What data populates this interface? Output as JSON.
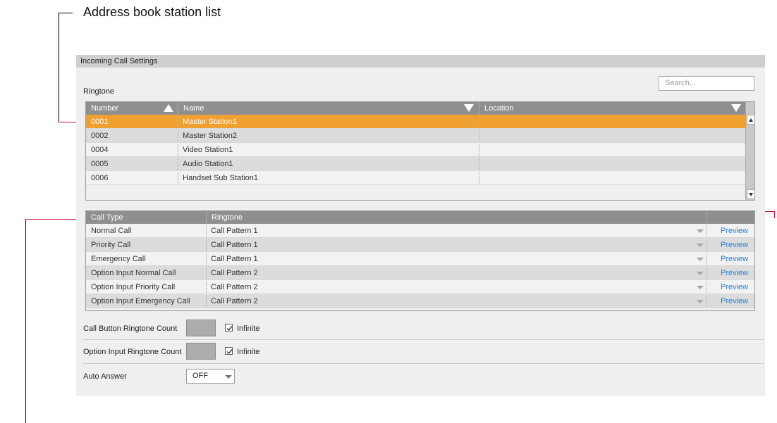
{
  "callout": {
    "title": "Address book station list"
  },
  "panel": {
    "header": "Incoming Call Settings",
    "search_placeholder": "Search...",
    "ringtone_label": "Ringtone"
  },
  "station_table": {
    "headers": {
      "number": "Number",
      "name": "Name",
      "location": "Location"
    },
    "rows": [
      {
        "number": "0001",
        "name": "Master Station1",
        "location": "",
        "selected": true
      },
      {
        "number": "0002",
        "name": "Master Station2",
        "location": ""
      },
      {
        "number": "0004",
        "name": "Video Station1",
        "location": ""
      },
      {
        "number": "0005",
        "name": "Audio Station1",
        "location": ""
      },
      {
        "number": "0006",
        "name": "Handset Sub Station1",
        "location": ""
      }
    ]
  },
  "ringtone_table": {
    "headers": {
      "call_type": "Call Type",
      "ringtone": "Ringtone"
    },
    "preview_label": "Preview",
    "rows": [
      {
        "call_type": "Normal Call",
        "ringtone": "Call Pattern 1"
      },
      {
        "call_type": "Priority Call",
        "ringtone": "Call Pattern 1"
      },
      {
        "call_type": "Emergency Call",
        "ringtone": "Call Pattern 1"
      },
      {
        "call_type": "Option Input Normal Call",
        "ringtone": "Call Pattern 2"
      },
      {
        "call_type": "Option Input Priority Call",
        "ringtone": "Call Pattern 2"
      },
      {
        "call_type": "Option Input Emergency Call",
        "ringtone": "Call Pattern 2"
      }
    ]
  },
  "settings": {
    "call_button_count": {
      "label": "Call Button Ringtone Count",
      "value": "",
      "infinite_label": "Infinite",
      "infinite_checked": true
    },
    "option_input_count": {
      "label": "Option Input Ringtone Count",
      "value": "",
      "infinite_label": "Infinite",
      "infinite_checked": true
    },
    "auto_answer": {
      "label": "Auto Answer",
      "value": "OFF"
    }
  },
  "colors": {
    "selected_row": "#f0a030",
    "header_bg": "#8f8f8f",
    "link": "#2a7fd4",
    "callout_line": "#c8102e"
  }
}
